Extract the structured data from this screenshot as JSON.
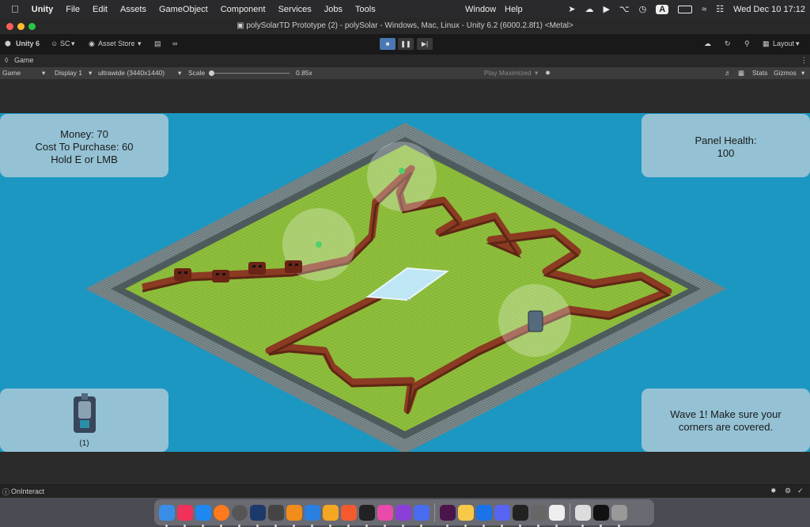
{
  "menubar": {
    "app": "Unity",
    "items": [
      "File",
      "Edit",
      "Assets",
      "GameObject",
      "Component",
      "Services",
      "Jobs",
      "Tools"
    ],
    "right_items": [
      "Window",
      "Help"
    ],
    "input_badge": "A",
    "datetime": "Wed Dec 10  17:12"
  },
  "window": {
    "title": "polySolarTD Prototype (2) - polySolar - Windows, Mac, Linux - Unity 6.2 (6000.2.8f1) <Metal>"
  },
  "toolbar": {
    "unity_version": "Unity 6",
    "account": "SC",
    "asset_store": "Asset Store",
    "layout": "Layout"
  },
  "game_tab": {
    "label": "Game",
    "display_mode": "Game",
    "display": "Display 1",
    "resolution": "ultrawide (3440x1440)",
    "scale_label": "Scale",
    "scale_value": "0.85x",
    "play_mode": "Play Maximized",
    "stats": "Stats",
    "gizmos": "Gizmos"
  },
  "hud": {
    "money_line": "Money: 70",
    "cost_line": "Cost To Purchase: 60",
    "hint_line": "Hold E or LMB",
    "health_line1": "Panel Health:",
    "health_line2": "100",
    "turret_count": "(1)",
    "wave_line1": "Wave 1! Make sure your",
    "wave_line2": "corners are covered."
  },
  "status": {
    "message": "OnInteract"
  },
  "colors": {
    "sky": "#1b97c2",
    "grass": "#8fbf3c",
    "path": "#8a3b22",
    "wall": "#7a8a8c",
    "panel": "#94c2d4"
  }
}
